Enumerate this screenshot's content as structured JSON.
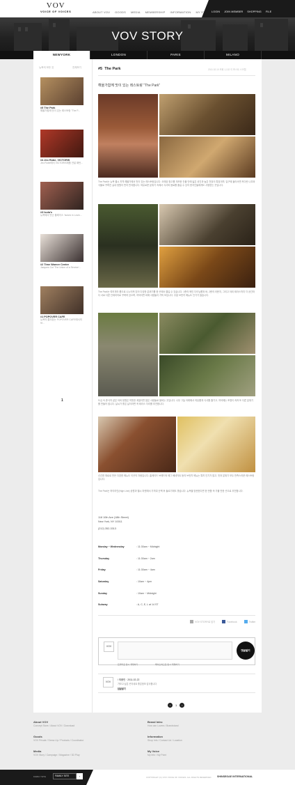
{
  "brand": {
    "name": "VOV",
    "tagline": "VOICE OF VOICES"
  },
  "nav": [
    "ABOUT VOV",
    "GOODS",
    "MEDIA",
    "MEMBERSHIP",
    "INFORMATION",
    "MY STORE"
  ],
  "util": [
    "LOGIN",
    "JOIN MEMBER",
    "SHOPPING",
    "FILE"
  ],
  "hero": {
    "title": "VOV STORY"
  },
  "cities": [
    "NEWYORK",
    "LONDON",
    "PARIS",
    "MILANO"
  ],
  "sidebar": {
    "head_left": "뉴욕의 모든 것",
    "head_right": "전체보기",
    "items": [
      {
        "title": "#5  The Park",
        "desc": "해울가함께 맛이 있는 레스토랑 \"The P...",
        "thumb": "#8a6a40"
      },
      {
        "title": "#4  Jeo Robe, VICTORIS",
        "desc": "Jeo Robe에서 VICTORIS제품 전달 패턴...",
        "thumb": "#5a2a20"
      },
      {
        "title": "#3  Isola's",
        "desc": "뉴욕에서 맛난 플레이스 'Isola's in Lovin...",
        "thumb": "#7a5040"
      },
      {
        "title": "#2  Time Warner Center",
        "desc": "Jacques Cut 'The Union of a Service'...",
        "thumb": "#6a6a6a"
      },
      {
        "title": "#1  POPOVER CAFE",
        "desc": "뉴욕의 즐겨찾는 POPOVER CAFE에서의 브...",
        "thumb": "#7a6048"
      }
    ],
    "more": "1"
  },
  "post": {
    "number": "#5",
    "title": "The Park",
    "meta": "2011.02.10  조회 1,132  이 포스트 스크랩",
    "subtitle": "해울가함께 맛이 있는 레스토랑 \"The Park\"",
    "p1": "The Park는 뉴욕 첼시 지역 해울가에서 맛이 있는 레스토랑입니다. 오래된 창고를 개조한 건물 안에 넓은 공간과 높은 천장이 특징이며, 입구에 들어서면 커다란 나무와 식물로 꾸며진 실내 정원이 먼저 반겨줍니다. 여유로운 분위기 속에서 식사와 음료를 즐길 수 있어 현지인들에게도 사랑받는 곳입니다.",
    "p2": "The Park는 여러개의 룸으로 나누어져 있어 다양한 분위기를 한 곳에서 즐길 수 있습니다. 1층의 메인 다이닝룸과 바, 2층의 라운지, 그리고 야외 테라스까지 각 공간마다 서로 다른 인테리어로 꾸며져 있으며, 저녁이면 바에 사람들이 가득 모입니다. 주말 브런치 메뉴도 인기가 많습니다.",
    "p3": "도심 속 휴식처 같은 야외 정원은 따뜻한 계절이면 많은 사람들로 붐비는 곳입니다. 나무 그늘 아래에서 여유롭게 식사를 즐기고, 저녁에는 조명이 켜져 또 다른 분위기를 만들어 냅니다. 날씨가 좋은 날이라면 꼭 테라스 자리를 추천합니다.",
    "p4": "신선한 재료로 만든 다양한 메뉴도 이곳의 자랑입니다. 홈메이드 브레드와 에그 베네딕트 등의 브런치 메뉴는 특히 인기가 많고, 맛과 분위기 모두 만족스러운 레스토랑입니다.",
    "p5": "The Park는 하이라인(High Line) 공원과 첼시 마켓에서 가까워 산책 후 들르기에도 좋습니다. 뉴욕을 방문한다면 한 번쯤 꼭 가볼 만한 곳으로 추천합니다.",
    "address": [
      "118 10th Ave (18th Street)",
      "New York, NY 10011"
    ],
    "phone": "(212) 352-3313",
    "hours": [
      {
        "day": "Monday ~ Wednesday",
        "time": ": 11:30am ~ Midnight"
      },
      {
        "day": "Thursday",
        "time": ": 11:30am ~ 2am"
      },
      {
        "day": "Friday",
        "time": ": 11:30am ~ 4am"
      },
      {
        "day": "Saturday",
        "time": ": 10am ~ 4pm"
      },
      {
        "day": "Sunday",
        "time": ": 10am ~ Midnight"
      },
      {
        "day": "Subway",
        "time": ": A, C, E, L at 14 ST"
      }
    ],
    "share": [
      "VOV STORY로 담기",
      "Facebook",
      "Twitter"
    ]
  },
  "comment_box": {
    "avatar": "VOV",
    "submit": "댓글달기",
    "opt1": "트위터로 동시 게재하기",
    "opt2": "페이스북으로 동시 게재하기"
  },
  "comments": [
    {
      "avatar": "VOV",
      "user": "/ 최중민 · 2011-02-22",
      "text": "가보고 싶은 곳이네요 좋은정보 감사합니다",
      "reply": "답글달기"
    }
  ],
  "pager": {
    "prev": "‹",
    "page": "1",
    "next": "›"
  },
  "footer": {
    "cols": [
      {
        "head": "About VOV",
        "links": "Concept Store / About VOV / Download"
      },
      {
        "head": "Goods",
        "links": "VOV Private / Dress Up / Products / Coordinator"
      },
      {
        "head": "Media",
        "links": "VOV Story / Campaign / Magazine / 3D Play"
      },
      {
        "head": "Brand Intro",
        "links": "How can Lovers / Brandstand"
      },
      {
        "head": "Information",
        "links": "Shop Info / Contact Us / Location"
      },
      {
        "head": "My Voice",
        "links": "My Info / My Point"
      }
    ]
  },
  "bottom": {
    "label": "FAMILY SITE",
    "select": "FAMILY SITE",
    "go": "›",
    "copy": "COPYRIGHT (C) VOV VOICE OF VOICES. ALL RIGHTS RESERVED.",
    "brand": "SHINSEGAE INTERNATIONAL"
  }
}
